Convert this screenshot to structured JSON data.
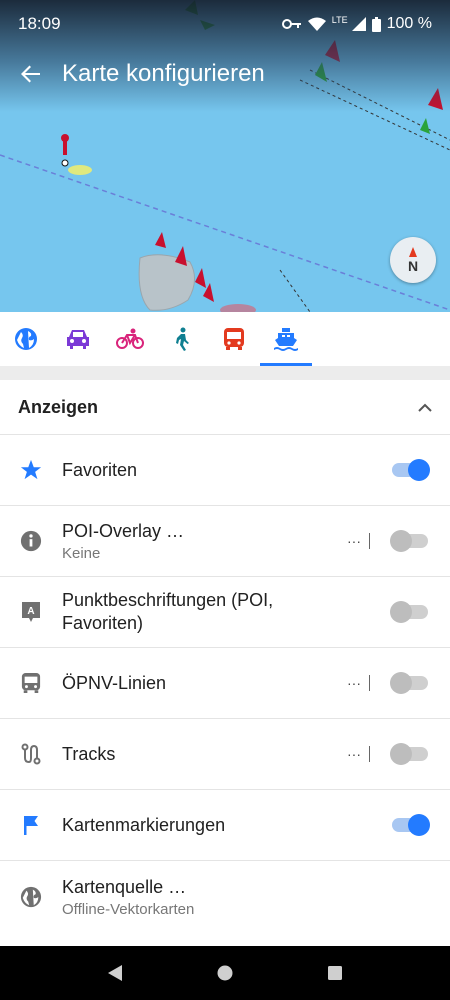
{
  "status_bar": {
    "time": "18:09",
    "network": "LTE",
    "battery": "100 %"
  },
  "app_bar": {
    "title": "Karte konfigurieren"
  },
  "map": {
    "compass_letter": "N"
  },
  "tabs": [
    {
      "name": "globe-icon",
      "color": "#237bff",
      "active": false
    },
    {
      "name": "car-icon",
      "color": "#7b39d6",
      "active": false
    },
    {
      "name": "bicycle-icon",
      "color": "#d9247b",
      "active": false
    },
    {
      "name": "pedestrian-icon",
      "color": "#0f7f91",
      "active": false
    },
    {
      "name": "bus-icon",
      "color": "#e33a1f",
      "active": false
    },
    {
      "name": "boat-icon",
      "color": "#237bff",
      "active": true
    }
  ],
  "section": {
    "title": "Anzeigen"
  },
  "rows": [
    {
      "title": "Favoriten",
      "subtitle": "",
      "icon": "star-icon",
      "more": false,
      "on": true
    },
    {
      "title": "POI-Overlay …",
      "subtitle": "Keine",
      "icon": "info-icon",
      "more": true,
      "on": false
    },
    {
      "title": "Punktbeschriftungen (POI,",
      "title2": "Favoriten)",
      "icon": "label-icon",
      "more": false,
      "on": false
    },
    {
      "title": "ÖPNV-Linien",
      "subtitle": "",
      "icon": "bus-icon",
      "more": true,
      "on": false
    },
    {
      "title": "Tracks",
      "subtitle": "",
      "icon": "track-icon",
      "more": true,
      "on": false
    },
    {
      "title": "Kartenmarkierungen",
      "subtitle": "",
      "icon": "flag-icon",
      "more": false,
      "on": true
    },
    {
      "title": "Kartenquelle …",
      "subtitle": "Offline-Vektorkarten",
      "icon": "globe-icon",
      "more": false,
      "on": null
    }
  ],
  "more_label": "···",
  "colors": {
    "accent": "#237bff",
    "water": "#76c6ee"
  }
}
